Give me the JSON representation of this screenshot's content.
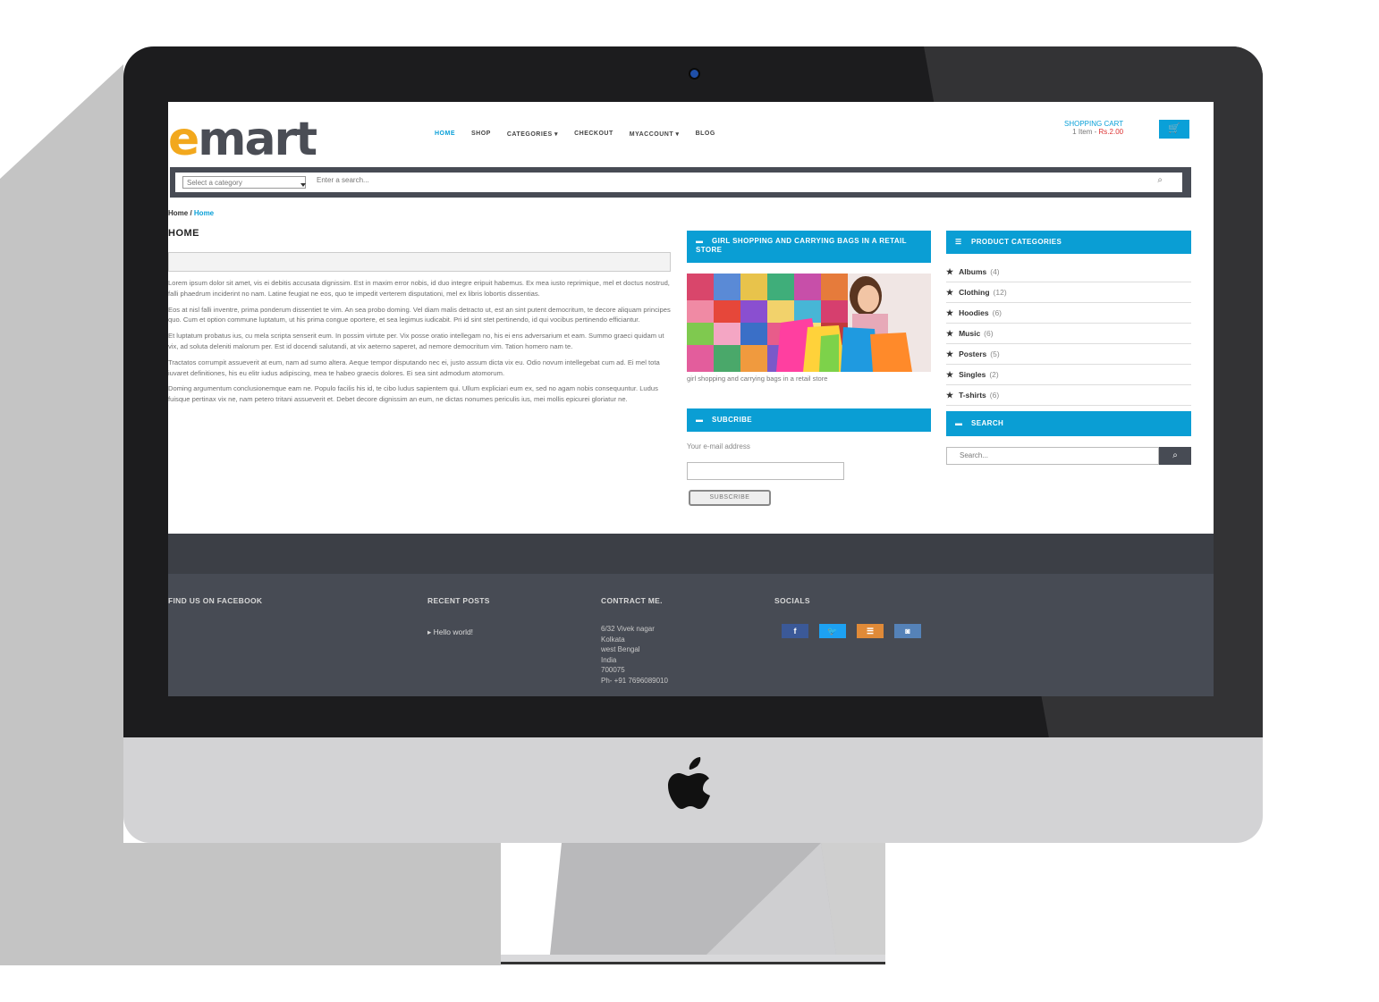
{
  "colors": {
    "accent": "#0aa0d8",
    "logo_orange": "#f2a81d",
    "dark": "#474b54",
    "price_red": "#dd3333"
  },
  "header": {
    "logo_e": "e",
    "logo_rest": "mart",
    "nav": [
      "HOME",
      "SHOP",
      "CATEGORIES ▾",
      "CHECKOUT",
      "MYACCOUNT ▾",
      "BLOG"
    ],
    "cart_title": "SHOPPING CART",
    "cart_items": "1 Item - ",
    "cart_price": "Rs.2.00"
  },
  "search": {
    "category_placeholder": "Select a category",
    "placeholder": "Enter a search..."
  },
  "breadcrumb": {
    "home": "Home",
    "current": "Home"
  },
  "page": {
    "title": "HOME",
    "paragraphs": [
      "Lorem ipsum dolor sit amet, vis ei debitis accusata dignissim. Est in maxim error nobis, id duo integre eripuit habemus. Ex mea iusto reprimique, mel et doctus nostrud, falli phaedrum inciderint no nam. Latine feugiat ne eos, quo te impedit verterem disputationi, mel ex libris lobortis dissentias.",
      "Eos at nisl falli inventre, prima ponderum dissentiet te vim. An sea probo doming. Vel diam malis detracto ut, est an sint putent democritum, te decore aliquam principes quo. Cum et option commune luptatum, ut his prima congue oportere, et sea legimus iudicabit. Pri id sint stet pertinendo, id qui vocibus pertinendo efficiantur.",
      "Et luptatum probatus ius, cu mela scripta senserit eum. In possim virtute per. Vix posse oratio intellegam no, his ei ens adversarium et eam. Summo graeci quidam ut vix, ad soluta deleniti malorum per. Est id docendi salutandi, at vix aeterno saperet, ad nemore democritum vim. Tation homero nam te.",
      "Tractatos corrumpit assueverit at eum, nam ad sumo altera. Aeque tempor disputando nec ei, justo assum dicta vix eu. Odio novum intellegebat cum ad. Ei mel tota iuvaret definitiones, his eu elitr iudus adipiscing, mea te habeo graecis dolores. Ei sea sint admodum atomorum.",
      "Doming argumentum conclusionemque eam ne. Populo facilis his id, te cibo ludus sapientem qui. Ullum expliciari eum ex, sed no agam nobis consequuntur. Ludus fuisque pertinax vix ne, nam petero tritani assueverit et. Debet decore dignissim an eum, ne dictas nonumes periculis ius, mei mollis epicurei gloriatur ne."
    ]
  },
  "widgets": {
    "image_title": "GIRL SHOPPING AND CARRYING BAGS IN A RETAIL STORE",
    "image_caption": "girl shopping and carrying bags in a retail store",
    "subscribe_title": "SUBCRIBE",
    "subscribe_label": "Your e-mail address",
    "subscribe_button": "SUBSCRIBE",
    "categories_title": "PRODUCT CATEGORIES",
    "categories": [
      {
        "name": "Albums",
        "count": "(4)"
      },
      {
        "name": "Clothing",
        "count": "(12)"
      },
      {
        "name": "Hoodies",
        "count": "(6)"
      },
      {
        "name": "Music",
        "count": "(6)"
      },
      {
        "name": "Posters",
        "count": "(5)"
      },
      {
        "name": "Singles",
        "count": "(2)"
      },
      {
        "name": "T-shirts",
        "count": "(6)"
      }
    ],
    "search_title": "SEARCH",
    "search_placeholder": "Search..."
  },
  "footer": {
    "facebook_heading": "FIND US ON FACEBOOK",
    "posts_heading": "RECENT POSTS",
    "post": "Hello world!",
    "contact_heading": "CONTRACT ME.",
    "address": [
      "6/32 Vivek nagar",
      "Kolkata",
      "west Bengal",
      "India",
      "700075",
      "Ph- +91 7696089010"
    ],
    "socials_heading": "SOCIALS",
    "socials": [
      {
        "icon": "facebook-icon",
        "glyph": "f",
        "color": "#3b5998"
      },
      {
        "icon": "twitter-icon",
        "glyph": "🐦",
        "color": "#1da1f2"
      },
      {
        "icon": "rss-icon",
        "glyph": "☰",
        "color": "#e08a38"
      },
      {
        "icon": "instagram-icon",
        "glyph": "◙",
        "color": "#5582b8"
      }
    ]
  }
}
